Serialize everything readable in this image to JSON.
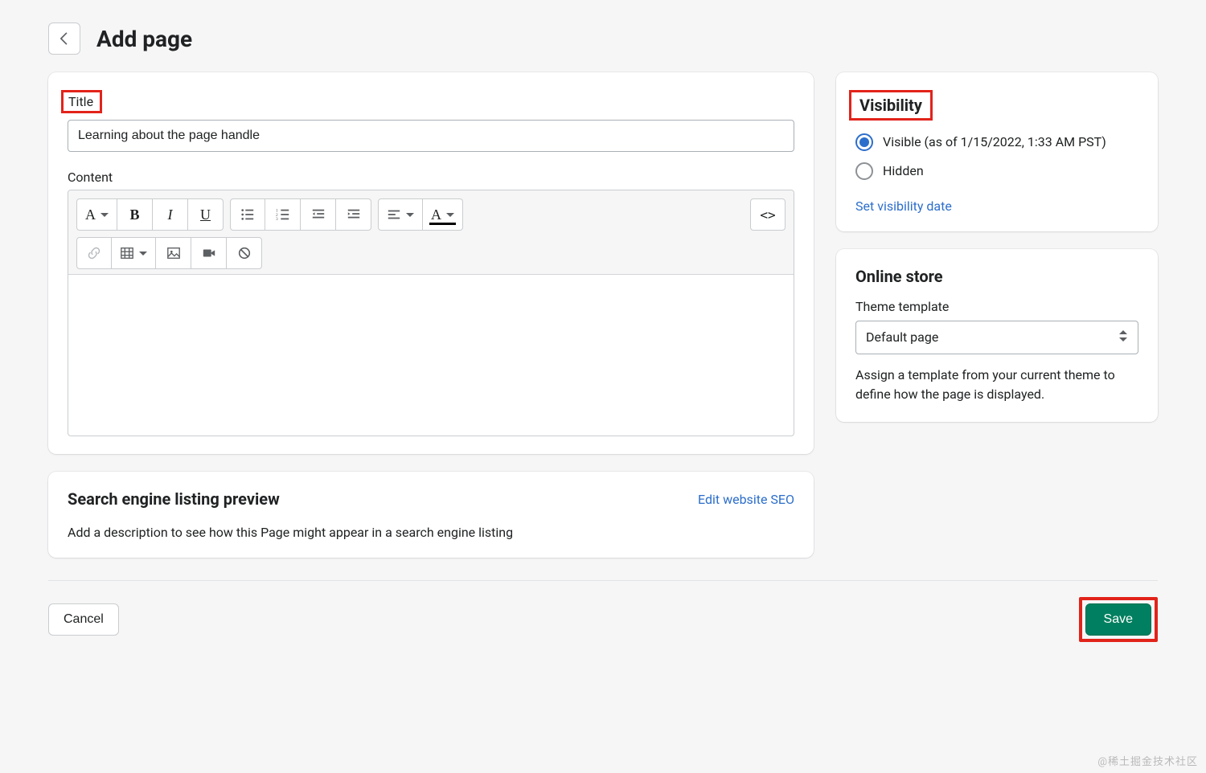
{
  "header": {
    "title": "Add page"
  },
  "main": {
    "titleLabel": "Title",
    "titleValue": "Learning about the page handle",
    "contentLabel": "Content",
    "contentValue": "",
    "toolbar": {
      "paragraph": "A",
      "bold": "B",
      "italic": "I",
      "underline": "U",
      "html": "<>"
    }
  },
  "seo": {
    "title": "Search engine listing preview",
    "editLink": "Edit website SEO",
    "desc": "Add a description to see how this Page might appear in a search engine listing"
  },
  "visibility": {
    "title": "Visibility",
    "visibleLabel": "Visible (as of 1/15/2022, 1:33 AM PST)",
    "hiddenLabel": "Hidden",
    "setDateLink": "Set visibility date"
  },
  "onlineStore": {
    "title": "Online store",
    "themeLabel": "Theme template",
    "selected": "Default page",
    "helper": "Assign a template from your current theme to define how the page is displayed."
  },
  "footer": {
    "cancel": "Cancel",
    "save": "Save"
  },
  "watermark": "@稀土掘金技术社区"
}
